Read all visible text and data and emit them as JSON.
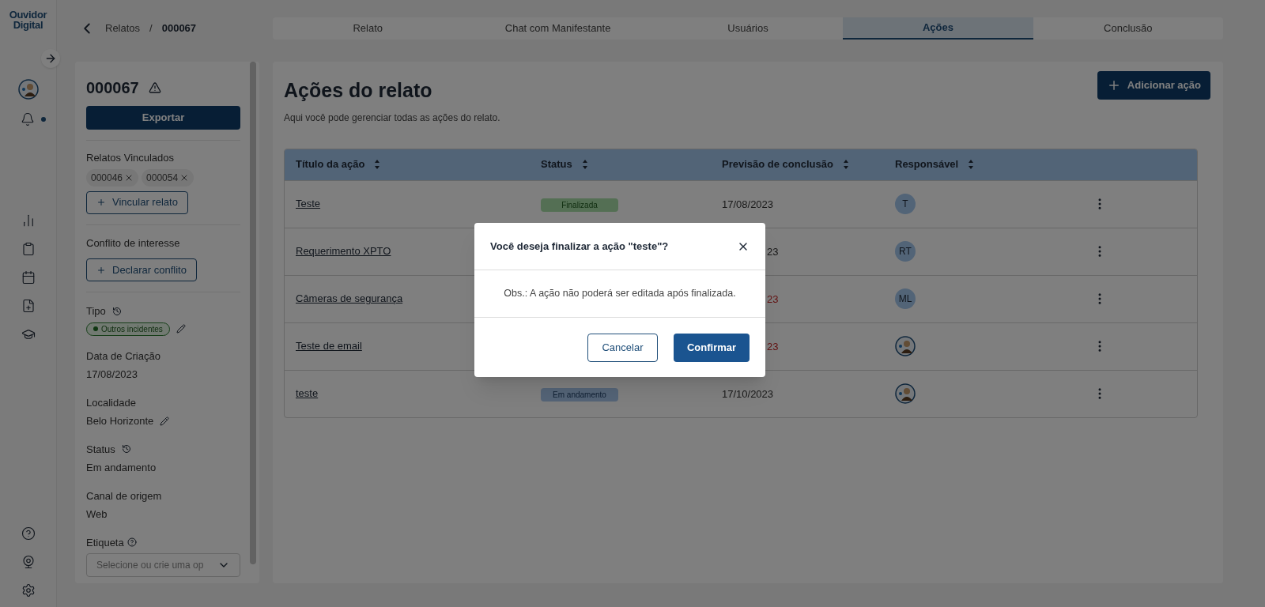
{
  "logo": {
    "line1": "Ouvidor",
    "line2": "Digital"
  },
  "sidebar": {
    "notification": true
  },
  "breadcrumb": {
    "parent": "Relatos",
    "separator": "/",
    "current": "000067"
  },
  "tabs": [
    {
      "label": "Relato",
      "selected": false
    },
    {
      "label": "Chat com Manifestante",
      "selected": false
    },
    {
      "label": "Usuários",
      "selected": false
    },
    {
      "label": "Ações",
      "selected": true
    },
    {
      "label": "Conclusão",
      "selected": false
    }
  ],
  "details": {
    "id": "000067",
    "export_button": "Exportar",
    "linked_label": "Relatos Vinculados",
    "linked": [
      "000046",
      "000054"
    ],
    "link_button": "Vincular relato",
    "conflict_label": "Conflito de interesse",
    "conflict_button": "Declarar conflito",
    "fields": [
      {
        "kind": "tag",
        "label": "Tipo",
        "value": "Outros incidentes",
        "history": true,
        "editable": true
      },
      {
        "kind": "text",
        "label": "Data de Criação",
        "value": "17/08/2023",
        "history": false,
        "editable": false
      },
      {
        "kind": "text",
        "label": "Localidade",
        "value": "Belo Horizonte",
        "history": false,
        "editable": true
      },
      {
        "kind": "text",
        "label": "Status",
        "value": "Em andamento",
        "history": true,
        "editable": false
      },
      {
        "kind": "text",
        "label": "Canal de origem",
        "value": "Web",
        "history": false,
        "editable": false
      }
    ],
    "tag_label": "Etiqueta",
    "tag_placeholder": "Selecione ou crie uma op"
  },
  "page": {
    "title": "Ações do relato",
    "subtitle": "Aqui você pode gerenciar todas as ações do relato.",
    "add_button": "Adicionar ação"
  },
  "table": {
    "columns": [
      "Título da ação",
      "Status",
      "Previsão de conclusão",
      "Responsável"
    ],
    "rows": [
      {
        "title": "Teste",
        "status": {
          "kind": "done",
          "label": "Finalizada"
        },
        "date": "17/08/2023",
        "overdue": false,
        "assignee": {
          "kind": "initials",
          "text": "T"
        }
      },
      {
        "title": "Requerimento XPTO",
        "date": "23",
        "date_cut": true,
        "overdue": false,
        "assignee": {
          "kind": "initials",
          "text": "RT"
        }
      },
      {
        "title": "Câmeras de segurança",
        "date": "23",
        "date_cut": true,
        "overdue": true,
        "assignee": {
          "kind": "initials",
          "text": "ML"
        }
      },
      {
        "title": "Teste de email",
        "date": "23",
        "date_cut": true,
        "overdue": true,
        "assignee": {
          "kind": "photo"
        }
      },
      {
        "title": "teste",
        "status": {
          "kind": "progress",
          "label": "Em andamento"
        },
        "date": "17/10/2023",
        "overdue": false,
        "assignee": {
          "kind": "photo"
        }
      }
    ]
  },
  "dialog": {
    "title": "Você deseja finalizar a ação \"teste\"?",
    "message": "Obs.: A ação não poderá ser editada após finalizada.",
    "cancel": "Cancelar",
    "confirm": "Confirmar"
  }
}
